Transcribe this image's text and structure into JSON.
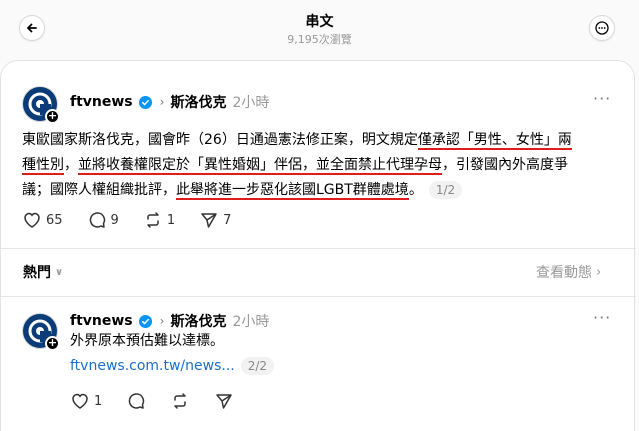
{
  "header": {
    "title": "串文",
    "views": "9,195次瀏覽"
  },
  "post1": {
    "username": "ftvnews",
    "topic": "斯洛伐克",
    "time": "2小時",
    "text_a": "東歐國家斯洛伐克，國會昨（26）日通過憲法修正案，明文規定",
    "text_u1": "僅承認「男性、女性」兩",
    "text_u2": "種性別",
    "text_b": "，",
    "text_u3": "並將收養權限定於「異性婚姻」伴侶，並全面禁止代理孕母",
    "text_c": "，引發國內外高度爭",
    "text_d": "議；國際人權組織批評，",
    "text_u4": "此舉將進一步惡化該國LGBT群體處境",
    "text_e": "。",
    "pager": "1/2",
    "likes": "65",
    "comments": "9",
    "reposts": "1",
    "shares": "7"
  },
  "sort": {
    "label": "熱門",
    "activity": "查看動態"
  },
  "post2": {
    "username": "ftvnews",
    "topic": "斯洛伐克",
    "time": "2小時",
    "text": "外界原本預估難以達標。",
    "link": "ftvnews.com.tw/news...",
    "pager": "2/2",
    "likes": "1"
  },
  "colors": {
    "underline": "#e01d1d",
    "link": "#1a6fc9",
    "verified": "#0095f6",
    "avatar_bg": "#0b3c78"
  }
}
